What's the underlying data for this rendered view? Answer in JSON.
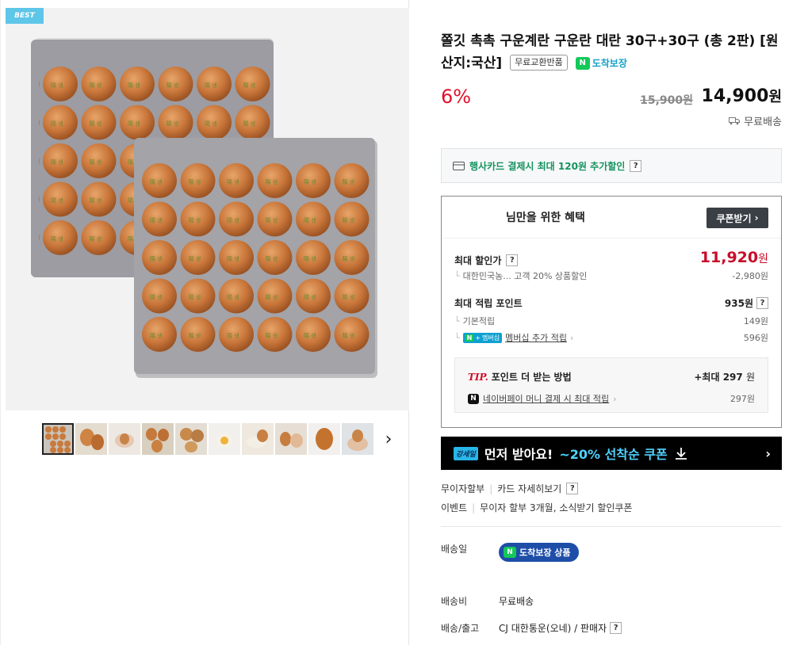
{
  "gallery": {
    "badge": "BEST",
    "thumb_count": 10,
    "next_icon": "chevron-right-icon"
  },
  "product": {
    "title": "쫄깃 촉촉 구운계란 구운란 대란 30구+30구 (총 2판) [원산지:국산]",
    "tag_free_exchange": "무료교환반품",
    "tag_arrive": "도착보장",
    "discount_rate": "6%",
    "original_price": "15,900원",
    "price_number": "14,900",
    "price_unit": "원",
    "shipping": "무료배송"
  },
  "card_promo": {
    "text": "행사카드 결제시 최대 120원 추가할인",
    "help": "?"
  },
  "benefit": {
    "title": "님만을 위한 혜택",
    "coupon_button": "쿠폰받기",
    "max_discount_label": "최대 할인가",
    "max_discount_price": "11,920",
    "max_discount_unit": "원",
    "discount_source": "대한민국농... 고객 20% 상품할인",
    "discount_amount": "-2,980원",
    "max_points_label": "최대 적립 포인트",
    "max_points_value": "935원",
    "basic_points_label": "기본적립",
    "basic_points_value": "149원",
    "member_chip_n": "N",
    "member_chip_plus": "+",
    "member_chip_text": "멤버십",
    "member_points_label": "멤버십 추가 적립",
    "member_points_value": "596원",
    "tip_word": "TIP.",
    "tip_title": "포인트 더 받는 방법",
    "tip_max_prefix": "+최대",
    "tip_max_value": "297",
    "tip_max_unit": "원",
    "tip_link": "네이버페이 머니 결제 시 최대 적립",
    "tip_value": "297원"
  },
  "first_coupon": {
    "logo": "강세일",
    "text": "먼저 받아요!",
    "accent": "~20% 선착순 쿠폰"
  },
  "installment": {
    "label": "무이자할부",
    "link": "카드 자세히보기"
  },
  "event": {
    "label": "이벤트",
    "text": "무이자 할부 3개월, 소식받기 할인쿠폰"
  },
  "delivery": {
    "date_label": "배송일",
    "arrive_pill": "도착보장 상품",
    "fee_label": "배송비",
    "fee_value": "무료배송",
    "courier_label": "배송/출고",
    "courier_value": "CJ 대한통운(오네) / 판매자"
  },
  "colors": {
    "discount_red": "#e0102b",
    "max_price_red": "#c80e2a",
    "naver_green": "#14c85a",
    "arrive_blue": "#1e4ea8"
  }
}
